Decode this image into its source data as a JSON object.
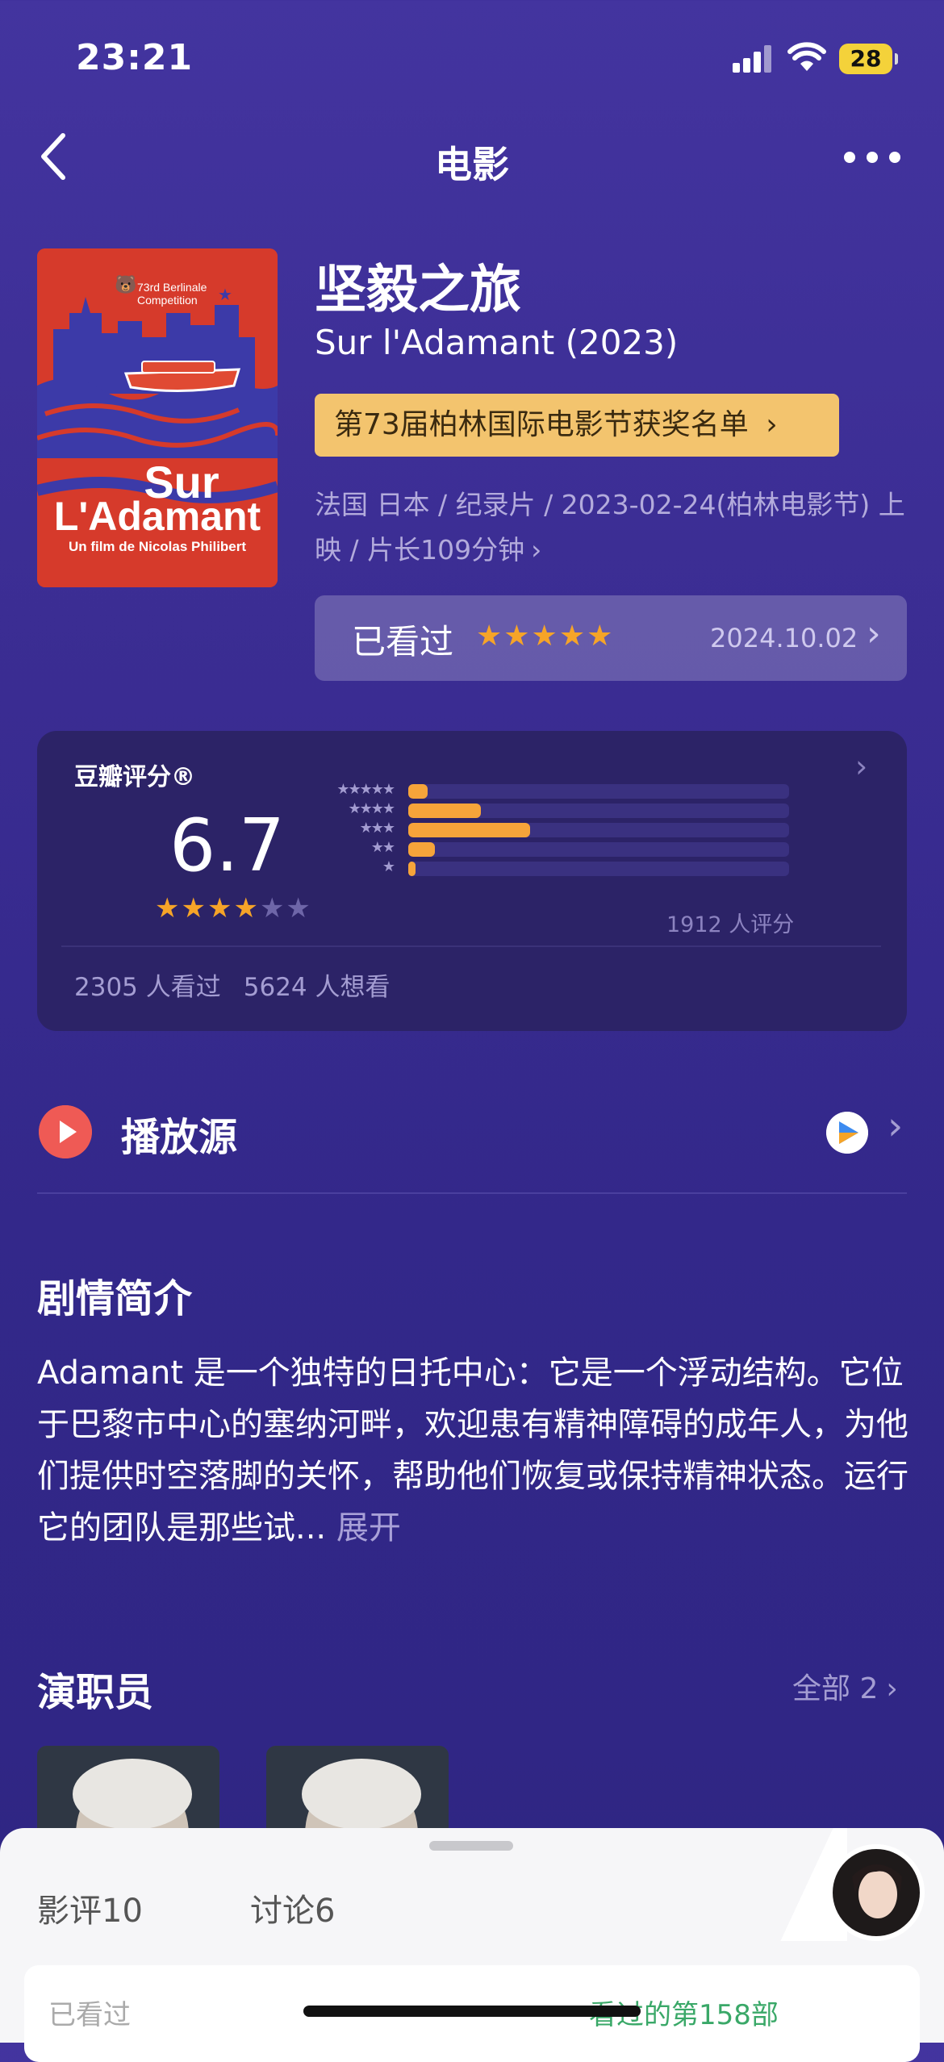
{
  "status_bar": {
    "time": "23:21",
    "battery": "28"
  },
  "nav": {
    "title": "电影"
  },
  "poster": {
    "festival_text": "73rd Berlinale Competition",
    "title_line1": "Sur",
    "title_line2": "L'Adamant",
    "subtitle": "Un film de Nicolas Philibert"
  },
  "movie": {
    "title_cn": "坚毅之旅",
    "title_en": "Sur l'Adamant (2023)",
    "award": "第73届柏林国际电影节获奖名单",
    "meta_line1": "法国 日本 / 纪录片 / 2023-02-24(柏林电影节) 上",
    "meta_line2": "映 / 片长109分钟"
  },
  "watched": {
    "label": "已看过",
    "stars": "★★★★★",
    "date": "2024.10.02"
  },
  "rating": {
    "label": "豆瓣评分®",
    "score": "6.7",
    "stars_full": "★★★",
    "stars_empty": "★★",
    "count": "1912 人评分",
    "watched_count": "2305 人看过",
    "want_count": "5624 人想看",
    "distribution": [
      {
        "stars": "★★★★★",
        "percent": 5
      },
      {
        "stars": "★★★★",
        "percent": 19
      },
      {
        "stars": "★★★",
        "percent": 32
      },
      {
        "stars": "★★",
        "percent": 7
      },
      {
        "stars": "★",
        "percent": 2
      }
    ]
  },
  "play_source": {
    "label": "播放源"
  },
  "synopsis": {
    "heading": "剧情简介",
    "text": "Adamant 是一个独特的日托中心：它是一个浮动结构。它位于巴黎市中心的塞纳河畔，欢迎患有精神障碍的成年人，为他们提供时空落脚的关怀，帮助他们恢复或保持精神状态。运行它的团队是那些试...",
    "expand": "展开"
  },
  "cast": {
    "heading": "演职员",
    "all_label": "全部 2"
  },
  "bottom_sheet": {
    "tab_reviews": "影评10",
    "tab_discussions": "讨论6",
    "card_left": "已看过",
    "card_right": "看过的第158部"
  },
  "colors": {
    "accent": "#f6a428",
    "award_bg": "#f3c46e",
    "play_red": "#ef5a55"
  }
}
